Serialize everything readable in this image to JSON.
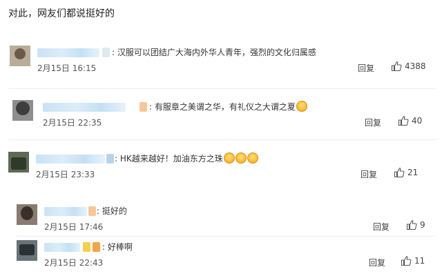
{
  "intro": "对此，网友们都说挺好的",
  "comments": [
    {
      "text": "汉服可以团结广大海内外华人青年，强烈的文化归属感",
      "date": "2月15日 16:15",
      "reply": "回复",
      "likes": "4388"
    },
    {
      "text": "有服章之美谓之华，有礼仪之大谓之夏",
      "date": "2月15日 22:35",
      "reply": "回复",
      "likes": "40"
    },
    {
      "text": "HK越来越好！加油东方之珠",
      "date": "2月15日 23:33",
      "reply": "回复",
      "likes": "21"
    },
    {
      "text": "挺好的",
      "date": "2月15日 17:46",
      "reply": "回复",
      "likes": "9"
    },
    {
      "text": "好棒啊",
      "date": "2月15日 22:43",
      "reply": "回复",
      "likes": "11"
    }
  ],
  "colors": {
    "link_blue": "#3a7fc1",
    "muted": "#555555"
  }
}
